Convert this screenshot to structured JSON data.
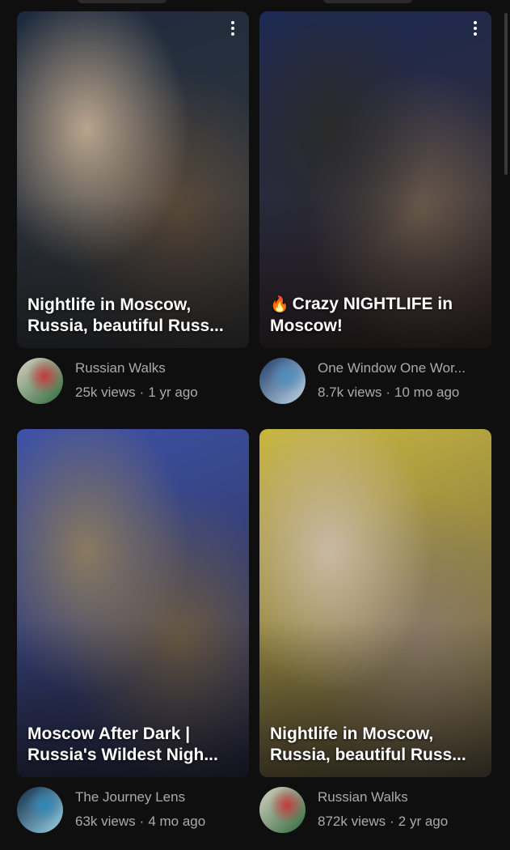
{
  "videos": [
    {
      "overlay_title": "Nightlife in Moscow,\nRussia, beautiful Russ...",
      "channel": "Russian Walks",
      "views": "25k views",
      "age": "1 yr ago",
      "thumb_colors": [
        "#1c2a3e",
        "#3b3a3a",
        "#5a4a3a",
        "#b9a48c"
      ],
      "avatar_colors": [
        "#d9d2c6",
        "#c23b3b",
        "#2d6a3a"
      ]
    },
    {
      "emoji": "🔥",
      "overlay_title": "Crazy NIGHTLIFE in\nMoscow!",
      "channel": "One Window One Wor...",
      "views": "8.7k views",
      "age": "10 mo ago",
      "thumb_colors": [
        "#1b2a55",
        "#3a2a25",
        "#6a5a4a",
        "#2b2b2b"
      ],
      "avatar_colors": [
        "#1f3b6a",
        "#4a8fc0",
        "#c0d8e8"
      ]
    },
    {
      "overlay_title": "Moscow After Dark |\nRussia's Wildest Nigh...",
      "channel": "The Journey Lens",
      "views": "63k views",
      "age": "4 mo ago",
      "thumb_colors": [
        "#3d52a8",
        "#2a2a40",
        "#6b5a44",
        "#8a7a60"
      ],
      "avatar_colors": [
        "#0f2a45",
        "#2f88b8",
        "#9ad4ea"
      ]
    },
    {
      "overlay_title": "Nightlife in Moscow,\nRussia, beautiful Russ...",
      "channel": "Russian Walks",
      "views": "872k views",
      "age": "2 yr ago",
      "thumb_colors": [
        "#c8b640",
        "#5a4f3e",
        "#8a7a68",
        "#c9b8a4"
      ],
      "avatar_colors": [
        "#d9d2c6",
        "#c23b3b",
        "#2d6a3a"
      ]
    }
  ]
}
